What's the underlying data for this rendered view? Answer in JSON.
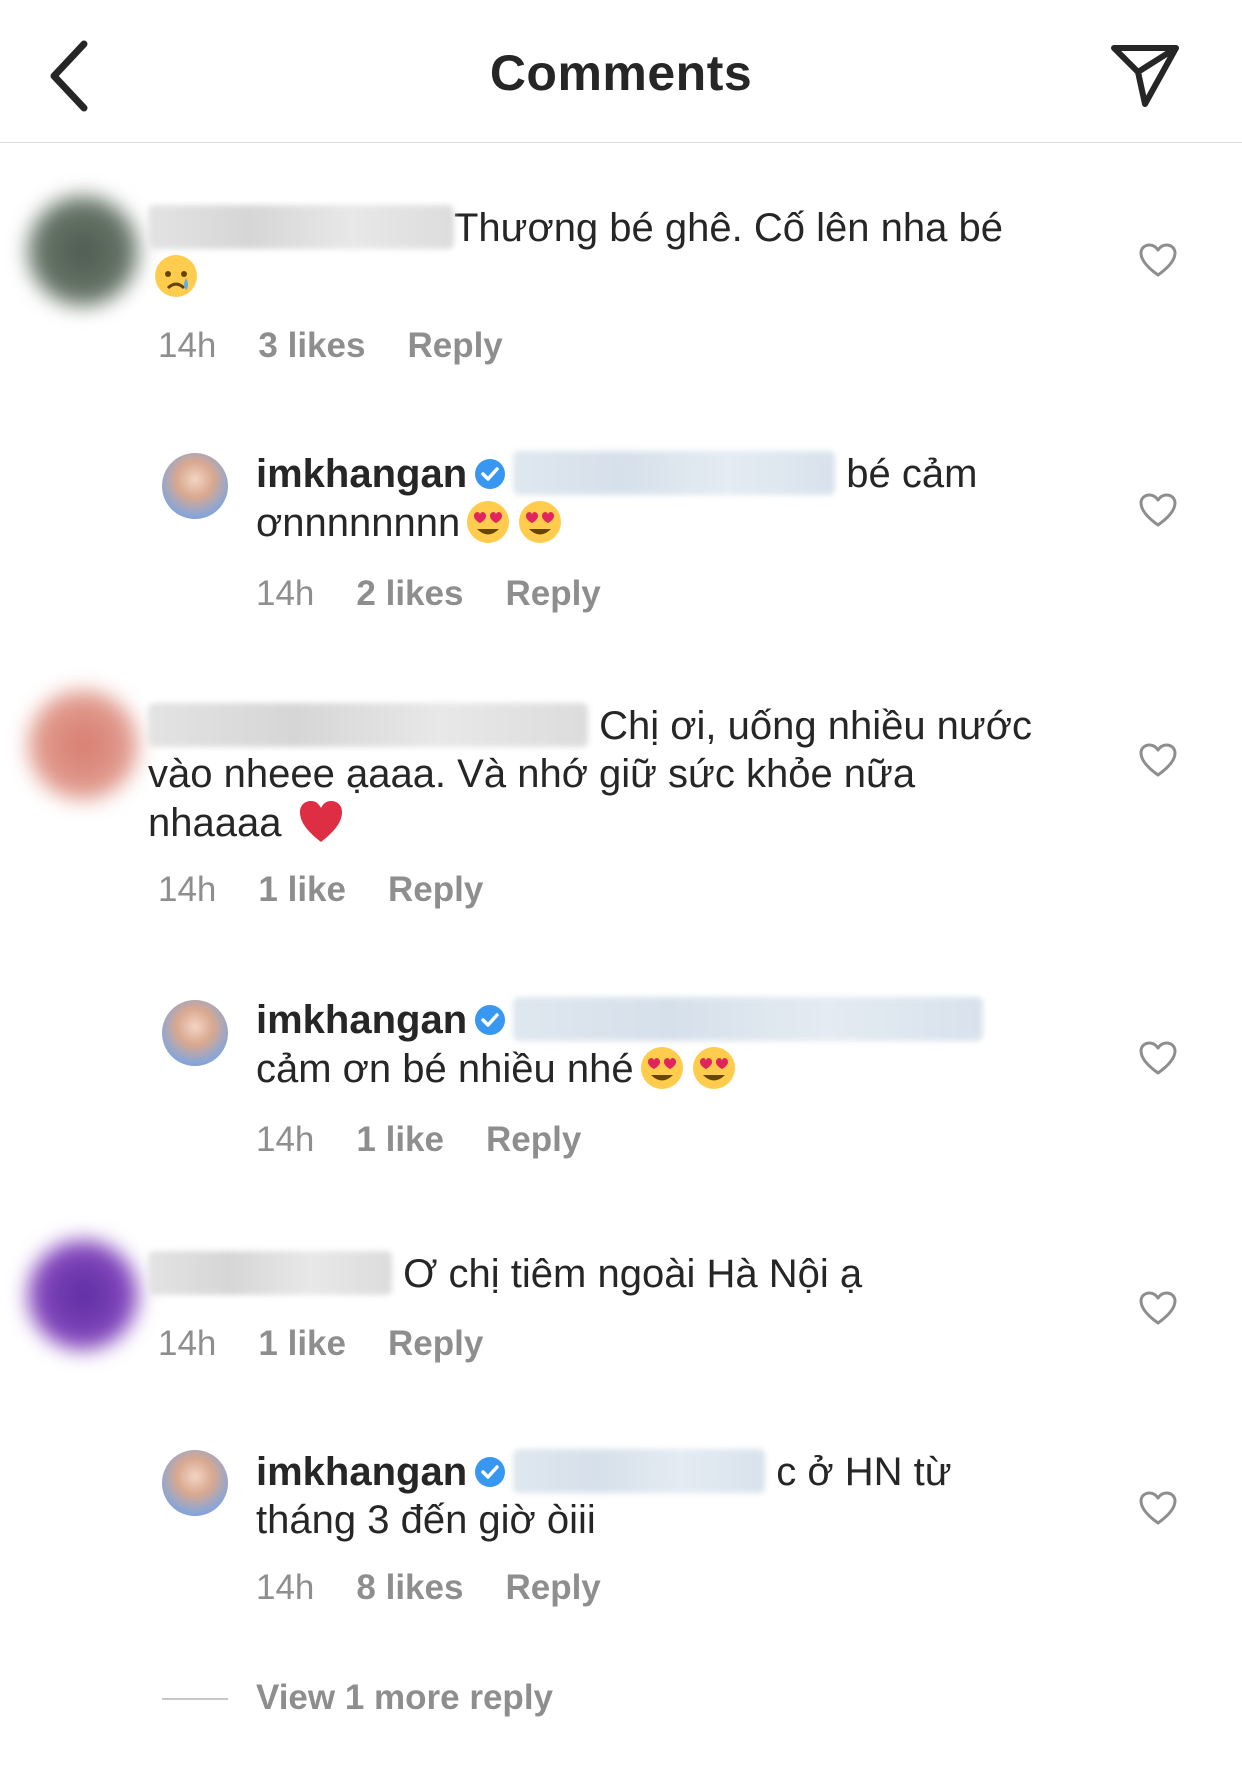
{
  "header": {
    "title": "Comments"
  },
  "comments": [
    {
      "text": "Thương bé ghê. Cố lên nha bé",
      "time": "14h",
      "likes": "3 likes",
      "reply": "Reply"
    },
    {
      "username": "imkhangan",
      "text_after": "bé cảm",
      "text_line2": "ơnnnnnnnn",
      "time": "14h",
      "likes": "2 likes",
      "reply": "Reply"
    },
    {
      "text_line1": "Chị ơi, uống nhiều nước",
      "text_line2": "vào nheee ạaaa. Và nhớ giữ sức khỏe nữa",
      "text_line3": "nhaaaa",
      "time": "14h",
      "likes": "1 like",
      "reply": "Reply"
    },
    {
      "username": "imkhangan",
      "text_line2": "cảm ơn bé nhiều nhé",
      "time": "14h",
      "likes": "1 like",
      "reply": "Reply"
    },
    {
      "text": "Ơ chị tiêm ngoài Hà Nội ạ",
      "time": "14h",
      "likes": "1 like",
      "reply": "Reply"
    },
    {
      "username": "imkhangan",
      "text_after": "c ở HN từ",
      "text_line2": "tháng 3 đến giờ òiii",
      "time": "14h",
      "likes": "8 likes",
      "reply": "Reply"
    }
  ],
  "view_more": "View 1 more reply",
  "colors": {
    "text": "#262626",
    "meta": "#8e8e8e",
    "verified": "#3897f0",
    "divider": "#dbdbdb"
  }
}
